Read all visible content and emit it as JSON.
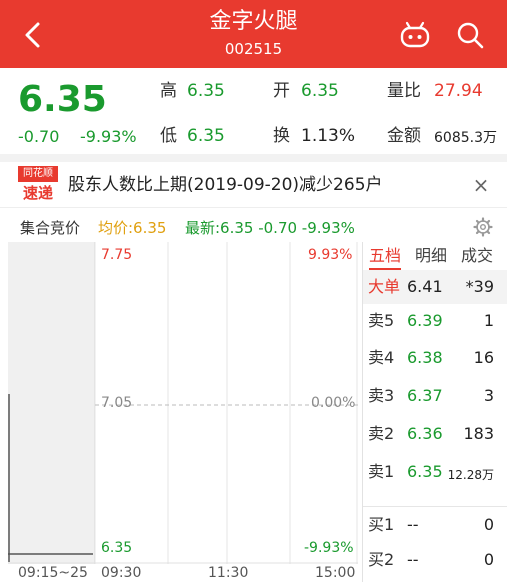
{
  "header": {
    "title": "金字火腿",
    "code": "002515"
  },
  "quote": {
    "price": "6.35",
    "change": "-0.70",
    "change_pct": "-9.93%",
    "high_label": "高",
    "high_value": "6.35",
    "open_label": "开",
    "open_value": "6.35",
    "volume_ratio_label": "量比",
    "volume_ratio_value": "27.94",
    "low_label": "低",
    "low_value": "6.35",
    "turnover_label": "换",
    "turnover_value": "1.13%",
    "amount_label": "金额",
    "amount_value": "6085.3万"
  },
  "news": {
    "logo_top": "同花顺",
    "logo_bottom": "速递",
    "text": "股东人数比上期(2019-09-20)减少265户",
    "close_glyph": "×"
  },
  "chart_header": {
    "auction_label": "集合竞价",
    "avg_label": "均价:6.35",
    "latest_label": "最新:6.35 -0.70 -9.93%"
  },
  "chart_data": {
    "type": "line",
    "ylim": [
      6.35,
      7.75
    ],
    "yticks_left": [
      "7.75",
      "7.05",
      "6.35"
    ],
    "yticks_right": [
      "9.93%",
      "0.00%",
      "-9.93%"
    ],
    "xticks": [
      "09:15~25",
      "09:30",
      "11:30",
      "15:00"
    ],
    "reference_price": 7.05,
    "series": [
      {
        "values": [
          6.35,
          6.35
        ]
      }
    ]
  },
  "book": {
    "tabs": [
      "五档",
      "明细",
      "成交"
    ],
    "big_order": {
      "label": "大单",
      "price": "6.41",
      "volume": "*39"
    },
    "asks": [
      {
        "label": "卖5",
        "price": "6.39",
        "volume": "1"
      },
      {
        "label": "卖4",
        "price": "6.38",
        "volume": "16"
      },
      {
        "label": "卖3",
        "price": "6.37",
        "volume": "3"
      },
      {
        "label": "卖2",
        "price": "6.36",
        "volume": "183"
      },
      {
        "label": "卖1",
        "price": "6.35",
        "volume": "12.28万"
      }
    ],
    "bids": [
      {
        "label": "买1",
        "price": "--",
        "volume": "0"
      },
      {
        "label": "买2",
        "price": "--",
        "volume": "0"
      }
    ]
  },
  "colors": {
    "accent": "#e83a2f",
    "down": "#1a9a2e",
    "avg": "#e0a010"
  }
}
